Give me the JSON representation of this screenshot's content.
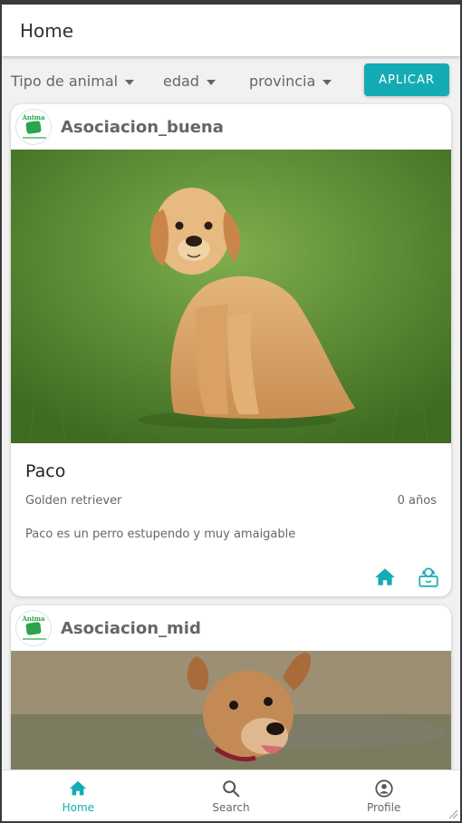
{
  "app_bar": {
    "title": "Home"
  },
  "filters": {
    "animal_type": "Tipo de animal",
    "age": "edad",
    "province": "provincia",
    "apply_label": "APLICAR"
  },
  "posts": [
    {
      "org_name": "Asociacion_buena",
      "org_logo_text": "Anima",
      "pet_name": "Paco",
      "breed": "Golden retriever",
      "age": "0 años",
      "description": "Paco es un perro estupendo y muy amaigable",
      "action_icons": [
        "home-icon",
        "adopt-box-icon"
      ]
    },
    {
      "org_name": "Asociacion_mid",
      "org_logo_text": "Anima"
    }
  ],
  "bottom_nav": [
    {
      "label": "Home",
      "icon": "home-icon",
      "active": true
    },
    {
      "label": "Search",
      "icon": "search-icon",
      "active": false
    },
    {
      "label": "Profile",
      "icon": "account-circle-icon",
      "active": false
    }
  ],
  "colors": {
    "accent": "#13acb4",
    "text_secondary": "#666666",
    "background": "#f1f1f1"
  }
}
